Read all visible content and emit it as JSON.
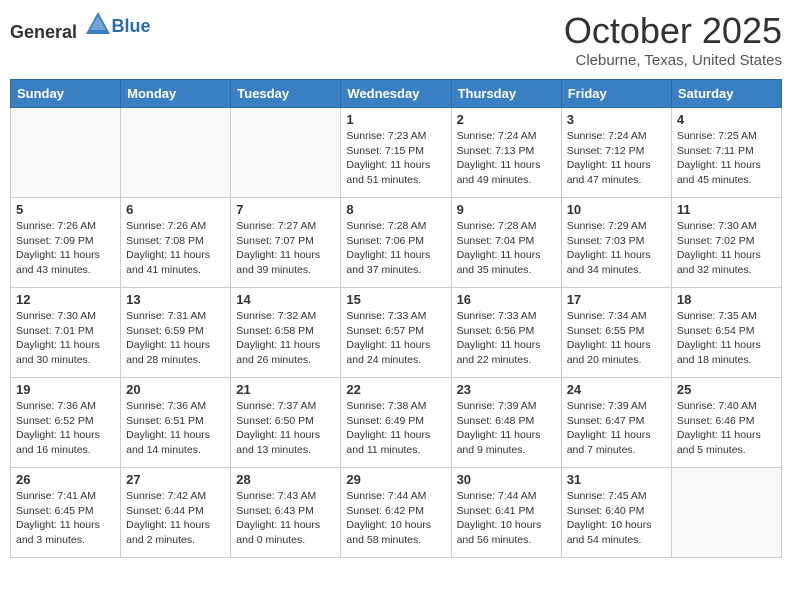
{
  "header": {
    "logo_general": "General",
    "logo_blue": "Blue",
    "month_title": "October 2025",
    "subtitle": "Cleburne, Texas, United States"
  },
  "weekdays": [
    "Sunday",
    "Monday",
    "Tuesday",
    "Wednesday",
    "Thursday",
    "Friday",
    "Saturday"
  ],
  "weeks": [
    [
      {
        "day": "",
        "sunrise": "",
        "sunset": "",
        "daylight": "",
        "empty": true
      },
      {
        "day": "",
        "sunrise": "",
        "sunset": "",
        "daylight": "",
        "empty": true
      },
      {
        "day": "",
        "sunrise": "",
        "sunset": "",
        "daylight": "",
        "empty": true
      },
      {
        "day": "1",
        "sunrise": "Sunrise: 7:23 AM",
        "sunset": "Sunset: 7:15 PM",
        "daylight": "Daylight: 11 hours and 51 minutes.",
        "empty": false
      },
      {
        "day": "2",
        "sunrise": "Sunrise: 7:24 AM",
        "sunset": "Sunset: 7:13 PM",
        "daylight": "Daylight: 11 hours and 49 minutes.",
        "empty": false
      },
      {
        "day": "3",
        "sunrise": "Sunrise: 7:24 AM",
        "sunset": "Sunset: 7:12 PM",
        "daylight": "Daylight: 11 hours and 47 minutes.",
        "empty": false
      },
      {
        "day": "4",
        "sunrise": "Sunrise: 7:25 AM",
        "sunset": "Sunset: 7:11 PM",
        "daylight": "Daylight: 11 hours and 45 minutes.",
        "empty": false
      }
    ],
    [
      {
        "day": "5",
        "sunrise": "Sunrise: 7:26 AM",
        "sunset": "Sunset: 7:09 PM",
        "daylight": "Daylight: 11 hours and 43 minutes.",
        "empty": false
      },
      {
        "day": "6",
        "sunrise": "Sunrise: 7:26 AM",
        "sunset": "Sunset: 7:08 PM",
        "daylight": "Daylight: 11 hours and 41 minutes.",
        "empty": false
      },
      {
        "day": "7",
        "sunrise": "Sunrise: 7:27 AM",
        "sunset": "Sunset: 7:07 PM",
        "daylight": "Daylight: 11 hours and 39 minutes.",
        "empty": false
      },
      {
        "day": "8",
        "sunrise": "Sunrise: 7:28 AM",
        "sunset": "Sunset: 7:06 PM",
        "daylight": "Daylight: 11 hours and 37 minutes.",
        "empty": false
      },
      {
        "day": "9",
        "sunrise": "Sunrise: 7:28 AM",
        "sunset": "Sunset: 7:04 PM",
        "daylight": "Daylight: 11 hours and 35 minutes.",
        "empty": false
      },
      {
        "day": "10",
        "sunrise": "Sunrise: 7:29 AM",
        "sunset": "Sunset: 7:03 PM",
        "daylight": "Daylight: 11 hours and 34 minutes.",
        "empty": false
      },
      {
        "day": "11",
        "sunrise": "Sunrise: 7:30 AM",
        "sunset": "Sunset: 7:02 PM",
        "daylight": "Daylight: 11 hours and 32 minutes.",
        "empty": false
      }
    ],
    [
      {
        "day": "12",
        "sunrise": "Sunrise: 7:30 AM",
        "sunset": "Sunset: 7:01 PM",
        "daylight": "Daylight: 11 hours and 30 minutes.",
        "empty": false
      },
      {
        "day": "13",
        "sunrise": "Sunrise: 7:31 AM",
        "sunset": "Sunset: 6:59 PM",
        "daylight": "Daylight: 11 hours and 28 minutes.",
        "empty": false
      },
      {
        "day": "14",
        "sunrise": "Sunrise: 7:32 AM",
        "sunset": "Sunset: 6:58 PM",
        "daylight": "Daylight: 11 hours and 26 minutes.",
        "empty": false
      },
      {
        "day": "15",
        "sunrise": "Sunrise: 7:33 AM",
        "sunset": "Sunset: 6:57 PM",
        "daylight": "Daylight: 11 hours and 24 minutes.",
        "empty": false
      },
      {
        "day": "16",
        "sunrise": "Sunrise: 7:33 AM",
        "sunset": "Sunset: 6:56 PM",
        "daylight": "Daylight: 11 hours and 22 minutes.",
        "empty": false
      },
      {
        "day": "17",
        "sunrise": "Sunrise: 7:34 AM",
        "sunset": "Sunset: 6:55 PM",
        "daylight": "Daylight: 11 hours and 20 minutes.",
        "empty": false
      },
      {
        "day": "18",
        "sunrise": "Sunrise: 7:35 AM",
        "sunset": "Sunset: 6:54 PM",
        "daylight": "Daylight: 11 hours and 18 minutes.",
        "empty": false
      }
    ],
    [
      {
        "day": "19",
        "sunrise": "Sunrise: 7:36 AM",
        "sunset": "Sunset: 6:52 PM",
        "daylight": "Daylight: 11 hours and 16 minutes.",
        "empty": false
      },
      {
        "day": "20",
        "sunrise": "Sunrise: 7:36 AM",
        "sunset": "Sunset: 6:51 PM",
        "daylight": "Daylight: 11 hours and 14 minutes.",
        "empty": false
      },
      {
        "day": "21",
        "sunrise": "Sunrise: 7:37 AM",
        "sunset": "Sunset: 6:50 PM",
        "daylight": "Daylight: 11 hours and 13 minutes.",
        "empty": false
      },
      {
        "day": "22",
        "sunrise": "Sunrise: 7:38 AM",
        "sunset": "Sunset: 6:49 PM",
        "daylight": "Daylight: 11 hours and 11 minutes.",
        "empty": false
      },
      {
        "day": "23",
        "sunrise": "Sunrise: 7:39 AM",
        "sunset": "Sunset: 6:48 PM",
        "daylight": "Daylight: 11 hours and 9 minutes.",
        "empty": false
      },
      {
        "day": "24",
        "sunrise": "Sunrise: 7:39 AM",
        "sunset": "Sunset: 6:47 PM",
        "daylight": "Daylight: 11 hours and 7 minutes.",
        "empty": false
      },
      {
        "day": "25",
        "sunrise": "Sunrise: 7:40 AM",
        "sunset": "Sunset: 6:46 PM",
        "daylight": "Daylight: 11 hours and 5 minutes.",
        "empty": false
      }
    ],
    [
      {
        "day": "26",
        "sunrise": "Sunrise: 7:41 AM",
        "sunset": "Sunset: 6:45 PM",
        "daylight": "Daylight: 11 hours and 3 minutes.",
        "empty": false
      },
      {
        "day": "27",
        "sunrise": "Sunrise: 7:42 AM",
        "sunset": "Sunset: 6:44 PM",
        "daylight": "Daylight: 11 hours and 2 minutes.",
        "empty": false
      },
      {
        "day": "28",
        "sunrise": "Sunrise: 7:43 AM",
        "sunset": "Sunset: 6:43 PM",
        "daylight": "Daylight: 11 hours and 0 minutes.",
        "empty": false
      },
      {
        "day": "29",
        "sunrise": "Sunrise: 7:44 AM",
        "sunset": "Sunset: 6:42 PM",
        "daylight": "Daylight: 10 hours and 58 minutes.",
        "empty": false
      },
      {
        "day": "30",
        "sunrise": "Sunrise: 7:44 AM",
        "sunset": "Sunset: 6:41 PM",
        "daylight": "Daylight: 10 hours and 56 minutes.",
        "empty": false
      },
      {
        "day": "31",
        "sunrise": "Sunrise: 7:45 AM",
        "sunset": "Sunset: 6:40 PM",
        "daylight": "Daylight: 10 hours and 54 minutes.",
        "empty": false
      },
      {
        "day": "",
        "sunrise": "",
        "sunset": "",
        "daylight": "",
        "empty": true
      }
    ]
  ]
}
